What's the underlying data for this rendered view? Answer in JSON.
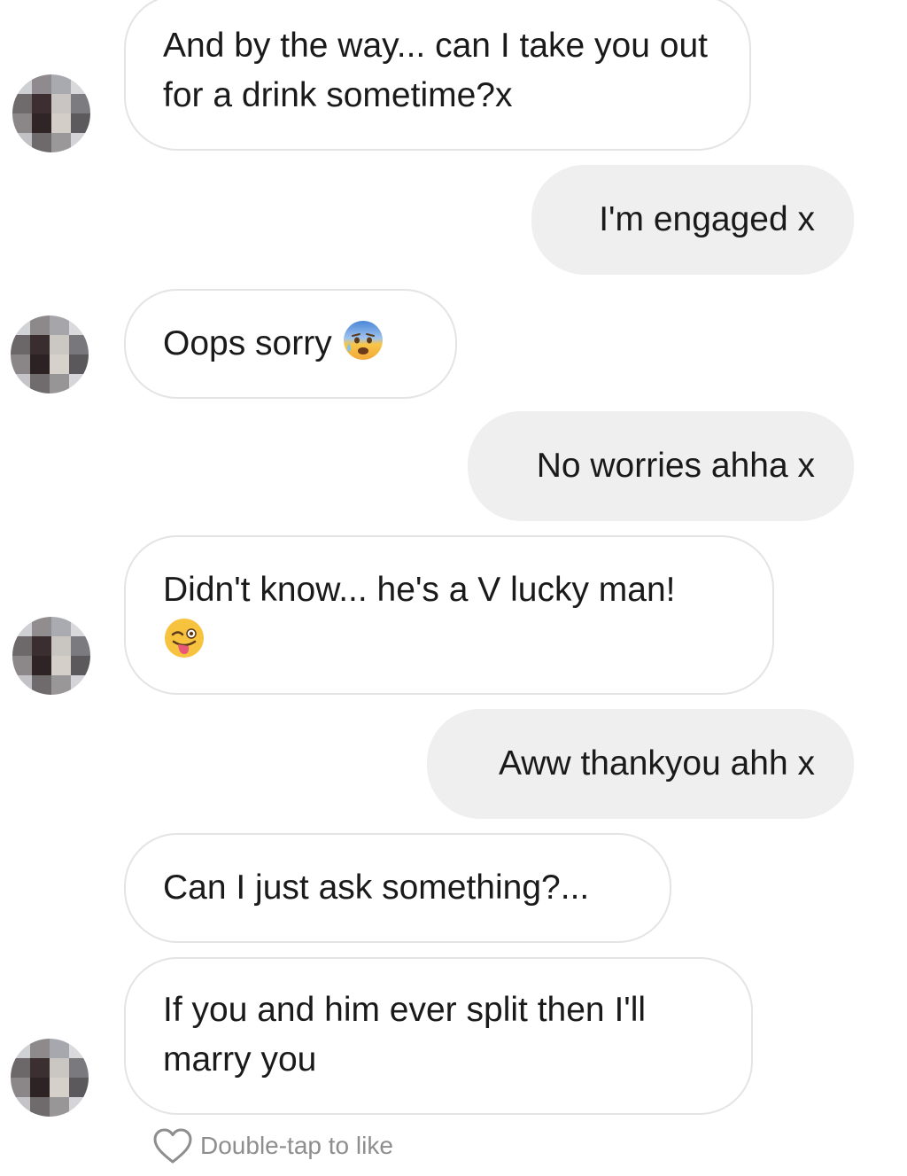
{
  "messages": [
    {
      "dir": "in",
      "text": "And by the way... can I take you out for a drink sometime?x"
    },
    {
      "dir": "out",
      "text": "I'm engaged x"
    },
    {
      "dir": "in",
      "text": "Oops sorry",
      "emoji": "anxious-face-with-sweat"
    },
    {
      "dir": "out",
      "text": "No worries ahha x"
    },
    {
      "dir": "in",
      "text": "Didn't know... he's a V lucky man!",
      "emoji": "winking-face-with-tongue"
    },
    {
      "dir": "out",
      "text": "Aww thankyou ahh x"
    },
    {
      "dir": "in",
      "text": "Can I just ask something?..."
    },
    {
      "dir": "in",
      "text": "If you and him ever split then I'll marry you"
    }
  ],
  "footer": {
    "like_hint": "Double-tap to like",
    "like_icon": "heart-outline-icon"
  },
  "colors": {
    "incoming_bubble": "#ffffff",
    "incoming_border": "#e4e4e4",
    "outgoing_bubble": "#efefef",
    "text": "#1a1a1a",
    "hint": "#8e8e8e"
  }
}
